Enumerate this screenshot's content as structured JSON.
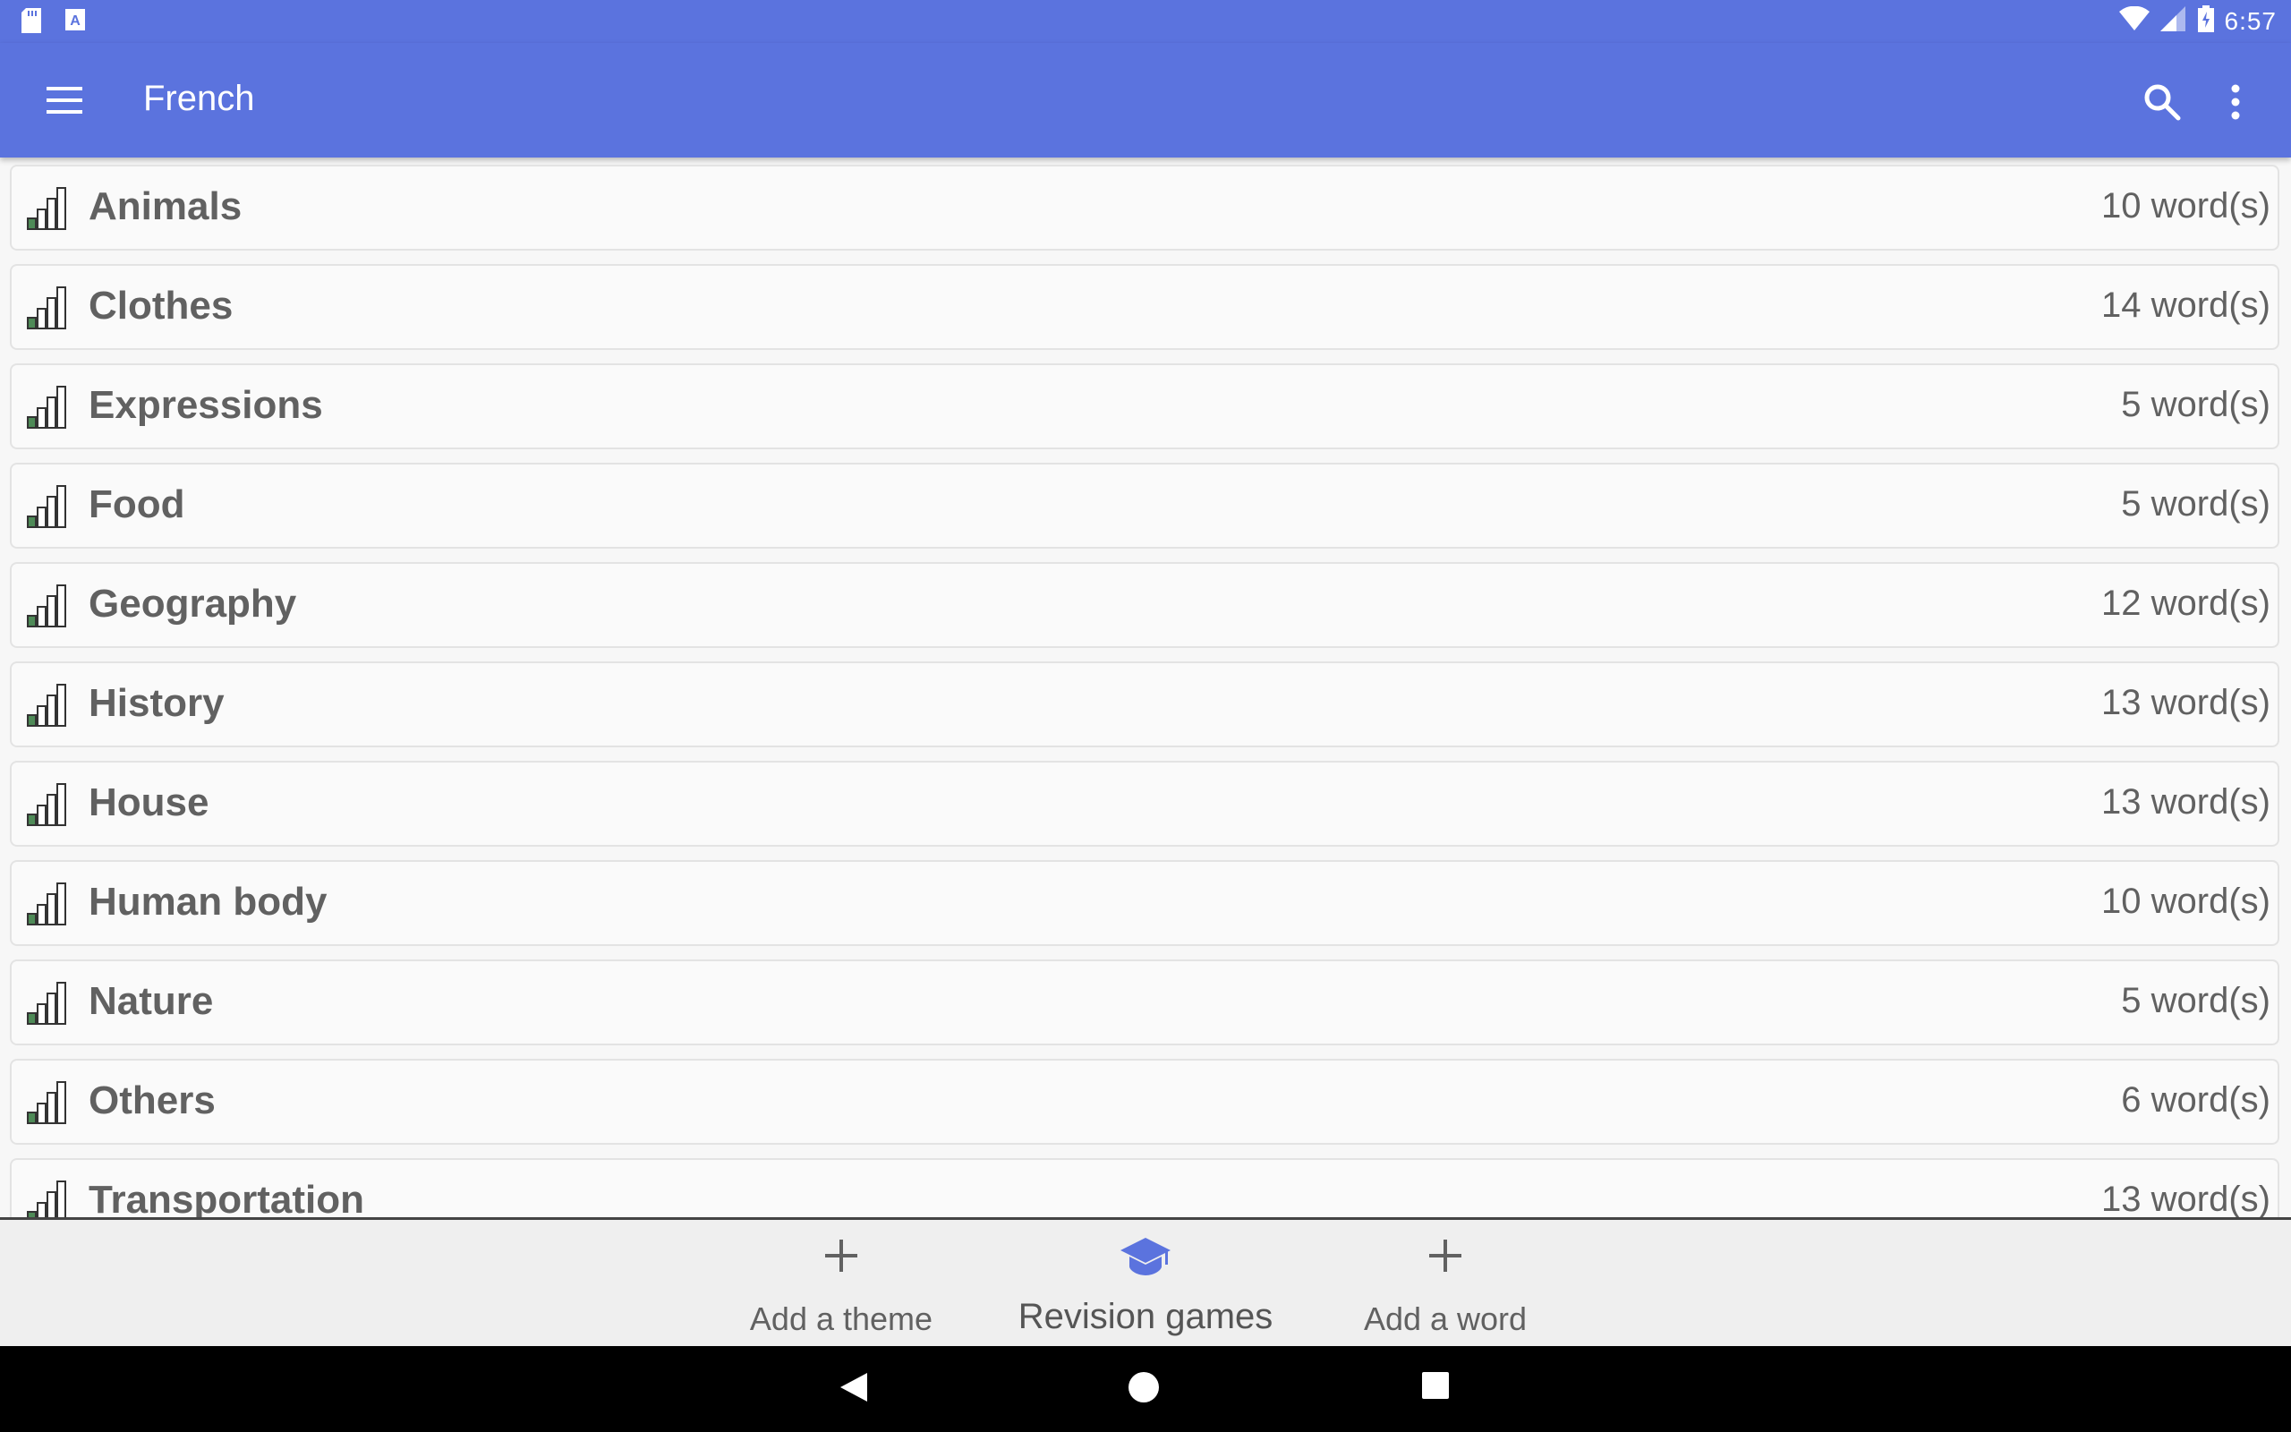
{
  "status_bar": {
    "time": "6:57",
    "left_icons": [
      "sd-card-icon",
      "keyboard-a-icon"
    ],
    "right_icons": [
      "wifi-icon",
      "cell-signal-icon",
      "battery-charging-icon"
    ]
  },
  "app_bar": {
    "title": "French",
    "background": "#5b73de"
  },
  "themes": [
    {
      "name": "Animals",
      "count": "10 word(s)"
    },
    {
      "name": "Clothes",
      "count": "14 word(s)"
    },
    {
      "name": "Expressions",
      "count": "5 word(s)"
    },
    {
      "name": "Food",
      "count": "5 word(s)"
    },
    {
      "name": "Geography",
      "count": "12 word(s)"
    },
    {
      "name": "History",
      "count": "13 word(s)"
    },
    {
      "name": "House",
      "count": "13 word(s)"
    },
    {
      "name": "Human body",
      "count": "10 word(s)"
    },
    {
      "name": "Nature",
      "count": "5 word(s)"
    },
    {
      "name": "Others",
      "count": "6 word(s)"
    },
    {
      "name": "Transportation",
      "count": "13 word(s)"
    }
  ],
  "bottom_bar": {
    "add_theme": "Add a theme",
    "revision_games": "Revision games",
    "add_word": "Add a word",
    "accent": "#5b73de"
  }
}
